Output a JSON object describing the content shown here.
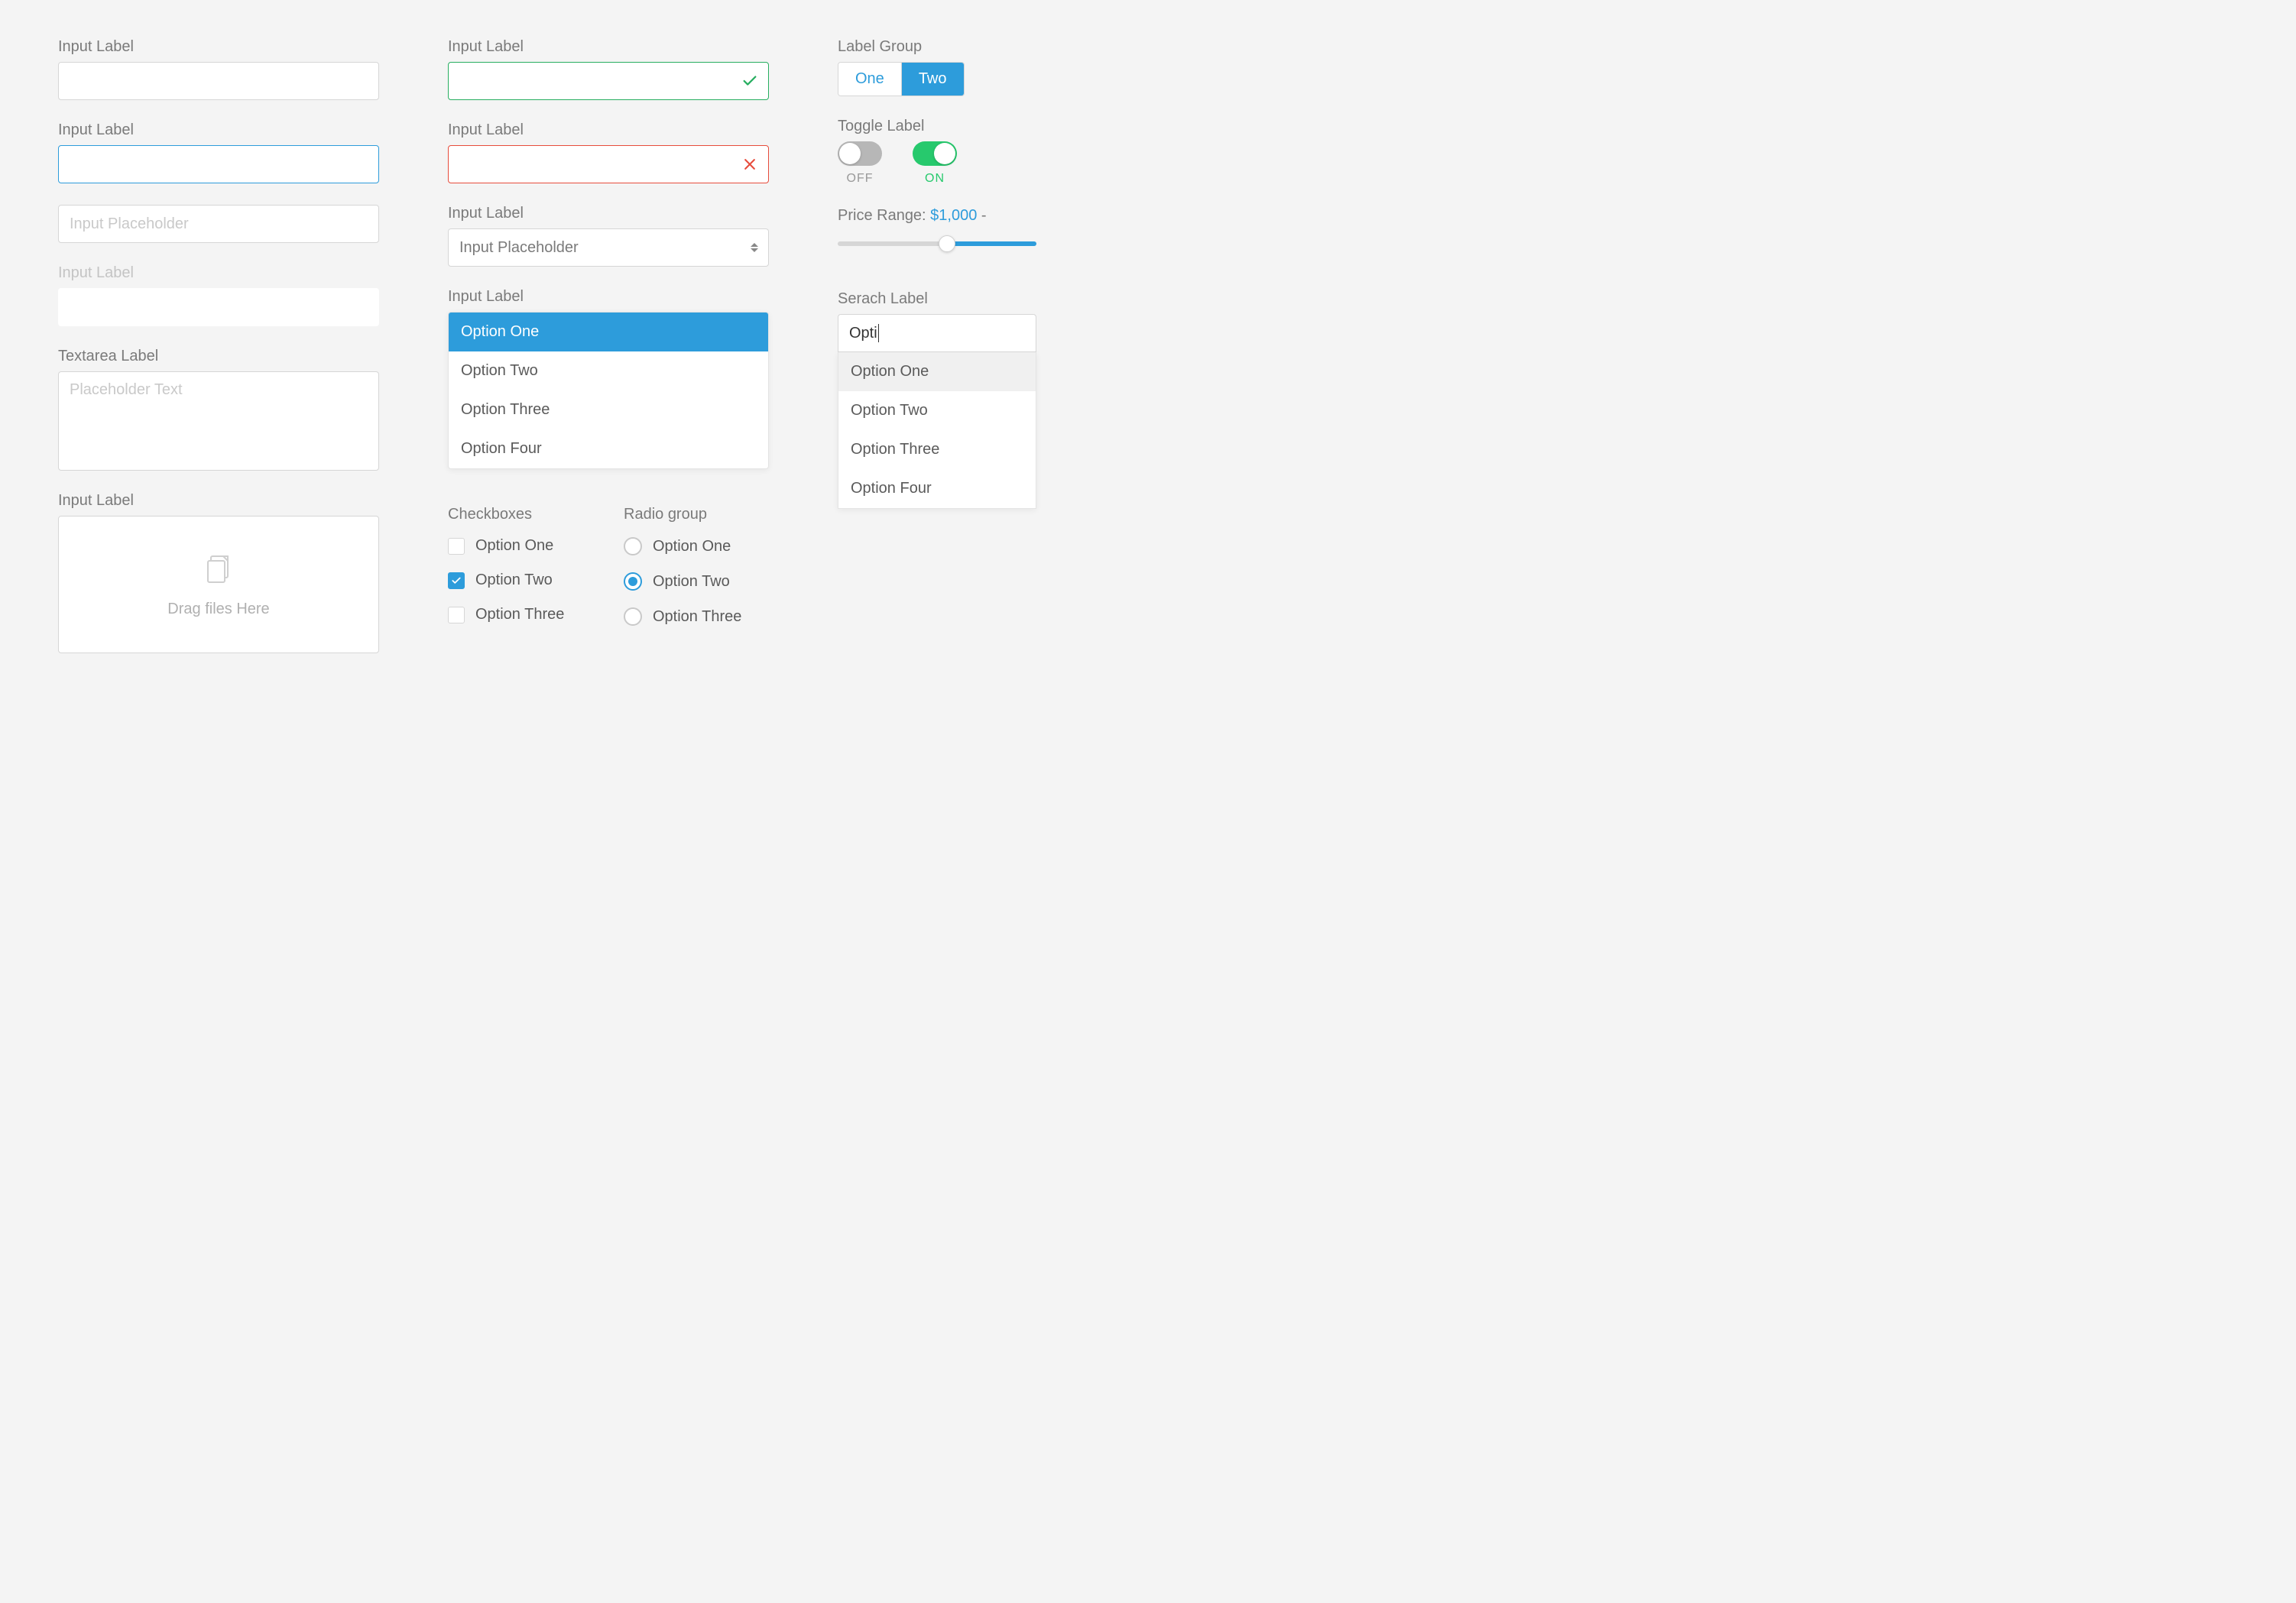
{
  "col1": {
    "input1_label": "Input Label",
    "input2_label": "Input Label",
    "input3_placeholder": "Input Placeholder",
    "input4_label": "Input Label",
    "textarea_label": "Textarea Label",
    "textarea_placeholder": "Placeholder Text",
    "drop_label": "Input Label",
    "drop_text": "Drag files Here"
  },
  "col2": {
    "success_label": "Input Label",
    "error_label": "Input Label",
    "select_label": "Input Label",
    "select_placeholder": "Input Placeholder",
    "listbox_label": "Input Label",
    "listbox_options": [
      "Option One",
      "Option Two",
      "Option Three",
      "Option Four"
    ],
    "checkbox_heading": "Checkboxes",
    "radio_heading": "Radio group",
    "check_options": [
      "Option One",
      "Option Two",
      "Option Three"
    ],
    "radio_options": [
      "Option One",
      "Option Two",
      "Option Three"
    ]
  },
  "col3": {
    "group_label": "Label Group",
    "group_options": [
      "One",
      "Two"
    ],
    "toggle_label": "Toggle Label",
    "toggle_off": "OFF",
    "toggle_on": "ON",
    "price_label": "Price Range: ",
    "price_value": "$1,000",
    "price_sep": " - ",
    "search_label": "Serach Label",
    "search_value": "Opti",
    "search_options": [
      "Option One",
      "Option Two",
      "Option Three",
      "Option Four"
    ]
  }
}
